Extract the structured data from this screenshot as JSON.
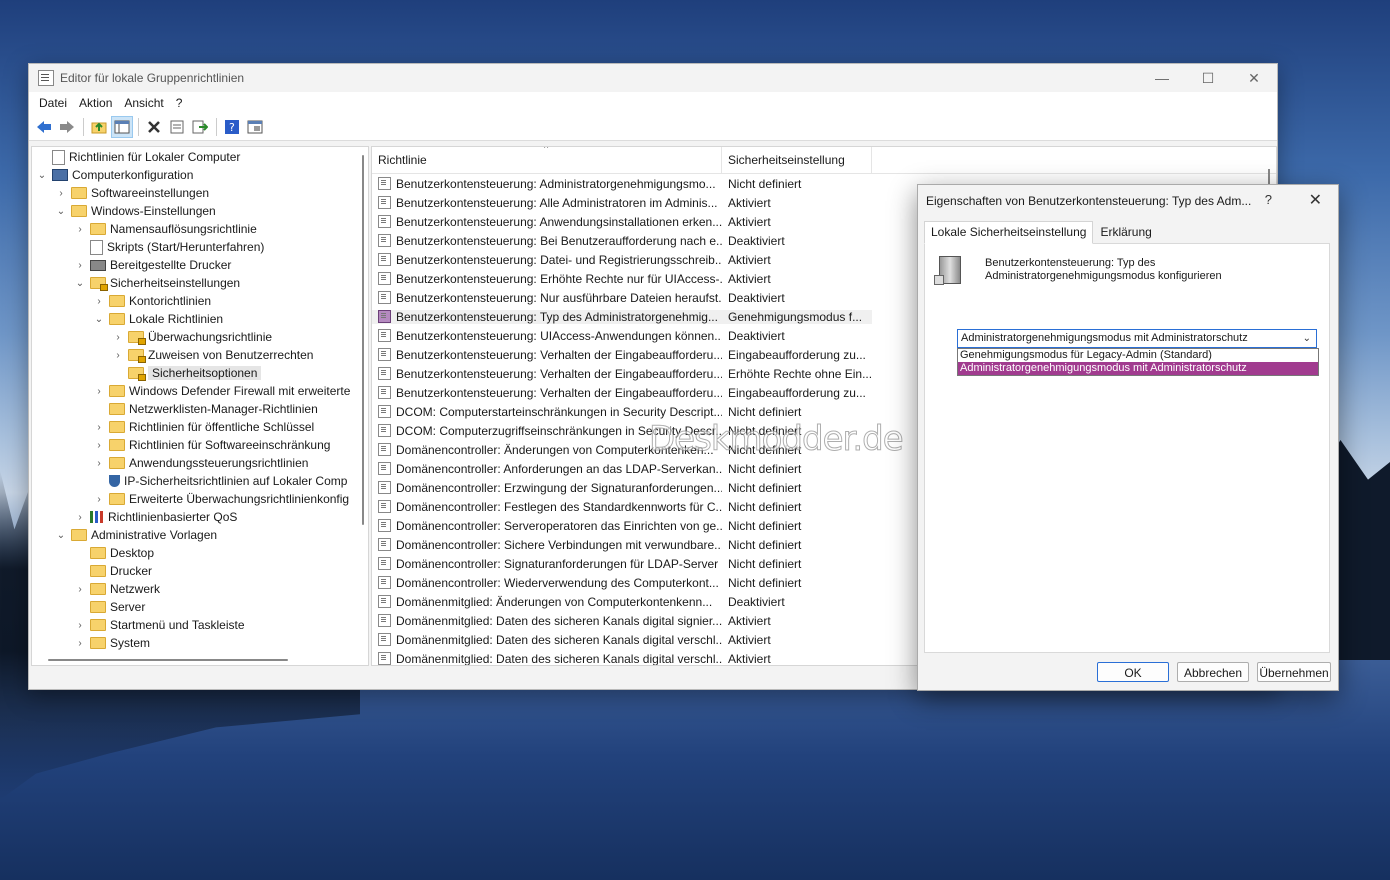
{
  "window": {
    "title": "Editor für lokale Gruppenrichtlinien",
    "controls": {
      "minimize": "—",
      "maximize": "☐",
      "close": "✕"
    }
  },
  "menu": [
    "Datei",
    "Aktion",
    "Ansicht",
    "?"
  ],
  "toolbar": [
    "back-icon",
    "forward-icon",
    "up-folder-icon",
    "show-hide-tree-icon",
    "delete-icon",
    "properties-icon",
    "export-icon",
    "help-icon",
    "console-icon"
  ],
  "tree": [
    {
      "label": "Richtlinien für Lokaler Computer",
      "depth": 0,
      "chevron": "",
      "icon": "doc"
    },
    {
      "label": "Computerkonfiguration",
      "depth": 0,
      "chevron": "⌄",
      "icon": "pc"
    },
    {
      "label": "Softwareeinstellungen",
      "depth": 1,
      "chevron": "›",
      "icon": "folder"
    },
    {
      "label": "Windows-Einstellungen",
      "depth": 1,
      "chevron": "⌄",
      "icon": "folder"
    },
    {
      "label": "Namensauflösungsrichtlinie",
      "depth": 2,
      "chevron": "›",
      "icon": "folder"
    },
    {
      "label": "Skripts (Start/Herunterfahren)",
      "depth": 2,
      "chevron": "",
      "icon": "doc"
    },
    {
      "label": "Bereitgestellte Drucker",
      "depth": 2,
      "chevron": "›",
      "icon": "printer"
    },
    {
      "label": "Sicherheitseinstellungen",
      "depth": 2,
      "chevron": "⌄",
      "icon": "folder lock"
    },
    {
      "label": "Kontorichtlinien",
      "depth": 3,
      "chevron": "›",
      "icon": "folder"
    },
    {
      "label": "Lokale Richtlinien",
      "depth": 3,
      "chevron": "⌄",
      "icon": "folder"
    },
    {
      "label": "Überwachungsrichtlinie",
      "depth": 4,
      "chevron": "›",
      "icon": "folder lock"
    },
    {
      "label": "Zuweisen von Benutzerrechten",
      "depth": 4,
      "chevron": "›",
      "icon": "folder lock"
    },
    {
      "label": "Sicherheitsoptionen",
      "depth": 4,
      "chevron": "",
      "icon": "folder lock",
      "selected": true
    },
    {
      "label": "Windows Defender Firewall mit erweiterte",
      "depth": 3,
      "chevron": "›",
      "icon": "folder"
    },
    {
      "label": "Netzwerklisten-Manager-Richtlinien",
      "depth": 3,
      "chevron": "",
      "icon": "folder"
    },
    {
      "label": "Richtlinien für öffentliche Schlüssel",
      "depth": 3,
      "chevron": "›",
      "icon": "folder"
    },
    {
      "label": "Richtlinien für Softwareeinschränkung",
      "depth": 3,
      "chevron": "›",
      "icon": "folder"
    },
    {
      "label": "Anwendungssteuerungsrichtlinien",
      "depth": 3,
      "chevron": "›",
      "icon": "folder"
    },
    {
      "label": "IP-Sicherheitsrichtlinien auf Lokaler Comp",
      "depth": 3,
      "chevron": "",
      "icon": "shield"
    },
    {
      "label": "Erweiterte Überwachungsrichtlinienkonfig",
      "depth": 3,
      "chevron": "›",
      "icon": "folder"
    },
    {
      "label": "Richtlinienbasierter QoS",
      "depth": 2,
      "chevron": "›",
      "icon": "qos"
    },
    {
      "label": "Administrative Vorlagen",
      "depth": 1,
      "chevron": "⌄",
      "icon": "folder"
    },
    {
      "label": "Desktop",
      "depth": 2,
      "chevron": "",
      "icon": "folder"
    },
    {
      "label": "Drucker",
      "depth": 2,
      "chevron": "",
      "icon": "folder"
    },
    {
      "label": "Netzwerk",
      "depth": 2,
      "chevron": "›",
      "icon": "folder"
    },
    {
      "label": "Server",
      "depth": 2,
      "chevron": "",
      "icon": "folder"
    },
    {
      "label": "Startmenü und Taskleiste",
      "depth": 2,
      "chevron": "›",
      "icon": "folder"
    },
    {
      "label": "System",
      "depth": 2,
      "chevron": "›",
      "icon": "folder"
    }
  ],
  "list": {
    "headers": [
      "Richtlinie",
      "Sicherheitseinstellung"
    ],
    "rows": [
      [
        "Benutzerkontensteuerung: Administratorgenehmigungsmo...",
        "Nicht definiert"
      ],
      [
        "Benutzerkontensteuerung: Alle Administratoren im Adminis...",
        "Aktiviert"
      ],
      [
        "Benutzerkontensteuerung: Anwendungsinstallationen erken...",
        "Aktiviert"
      ],
      [
        "Benutzerkontensteuerung: Bei Benutzeraufforderung nach e...",
        "Deaktiviert"
      ],
      [
        "Benutzerkontensteuerung: Datei- und Registrierungsschreib...",
        "Aktiviert"
      ],
      [
        "Benutzerkontensteuerung: Erhöhte Rechte nur für UIAccess-...",
        "Aktiviert"
      ],
      [
        "Benutzerkontensteuerung: Nur ausführbare Dateien heraufst...",
        "Deaktiviert"
      ],
      [
        "Benutzerkontensteuerung: Typ des Administratorgenehmig...",
        "Genehmigungsmodus f..."
      ],
      [
        "Benutzerkontensteuerung: UIAccess-Anwendungen können...",
        "Deaktiviert"
      ],
      [
        "Benutzerkontensteuerung: Verhalten der Eingabeaufforderu...",
        "Eingabeaufforderung zu..."
      ],
      [
        "Benutzerkontensteuerung: Verhalten der Eingabeaufforderu...",
        "Erhöhte Rechte ohne Ein..."
      ],
      [
        "Benutzerkontensteuerung: Verhalten der Eingabeaufforderu...",
        "Eingabeaufforderung zu..."
      ],
      [
        "DCOM: Computerstarteinschränkungen in Security Descript...",
        "Nicht definiert"
      ],
      [
        "DCOM: Computerzugriffseinschränkungen in Security Descr...",
        "Nicht definiert"
      ],
      [
        "Domänencontroller: Änderungen von Computerkontenken...",
        "Nicht definiert"
      ],
      [
        "Domänencontroller: Anforderungen an das LDAP-Serverkan...",
        "Nicht definiert"
      ],
      [
        "Domänencontroller: Erzwingung der Signaturanforderungen...",
        "Nicht definiert"
      ],
      [
        "Domänencontroller: Festlegen des Standardkennworts für C...",
        "Nicht definiert"
      ],
      [
        "Domänencontroller: Serveroperatoren das Einrichten von ge...",
        "Nicht definiert"
      ],
      [
        "Domänencontroller: Sichere Verbindungen mit verwundbare...",
        "Nicht definiert"
      ],
      [
        "Domänencontroller: Signaturanforderungen für LDAP-Server",
        "Nicht definiert"
      ],
      [
        "Domänencontroller: Wiederverwendung des Computerkont...",
        "Nicht definiert"
      ],
      [
        "Domänenmitglied: Änderungen von Computerkontenkenn...",
        "Deaktiviert"
      ],
      [
        "Domänenmitglied: Daten des sicheren Kanals digital signier...",
        "Aktiviert"
      ],
      [
        "Domänenmitglied: Daten des sicheren Kanals digital verschl...",
        "Aktiviert"
      ],
      [
        "Domänenmitglied: Daten des sicheren Kanals digital verschl...",
        "Aktiviert"
      ]
    ],
    "selected_index": 7
  },
  "watermark": "Deskmodder.de",
  "dialog": {
    "title": "Eigenschaften von Benutzerkontensteuerung: Typ des Adm...",
    "help": "?",
    "close": "✕",
    "tabs": [
      "Lokale Sicherheitseinstellung",
      "Erklärung"
    ],
    "description_line1": "Benutzerkontensteuerung: Typ des",
    "description_line2": "Administratorgenehmigungsmodus konfigurieren",
    "combo_value": "Administratorgenehmigungsmodus mit Administratorschutz",
    "options": [
      "Genehmigungsmodus für Legacy-Admin (Standard)",
      "Administratorgenehmigungsmodus mit Administratorschutz"
    ],
    "highlighted_option": 1,
    "buttons": {
      "ok": "OK",
      "cancel": "Abbrechen",
      "apply": "Übernehmen"
    }
  },
  "colors": {
    "selection": "#a13b8f",
    "focus": "#2a6fd6",
    "folder": "#f7d26b"
  }
}
